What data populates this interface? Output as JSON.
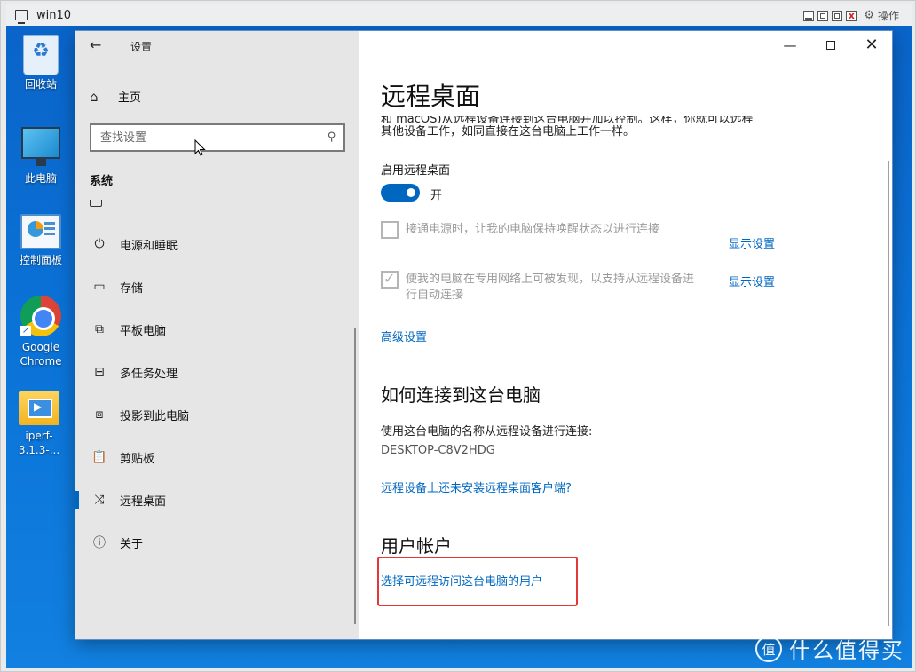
{
  "vm": {
    "title": "win10",
    "ops_label": "操作"
  },
  "desktop_icons": [
    {
      "label": "回收站"
    },
    {
      "label": "此电脑"
    },
    {
      "label": "控制面板"
    },
    {
      "label": "Google Chrome"
    },
    {
      "label": "iperf-3.1.3-..."
    }
  ],
  "settings": {
    "app_title": "设置",
    "home_label": "主页",
    "search_placeholder": "查找设置",
    "group_title": "系统",
    "nav_items": [
      {
        "label": "电源和睡眠",
        "icon": "power-icon"
      },
      {
        "label": "存储",
        "icon": "storage-icon"
      },
      {
        "label": "平板电脑",
        "icon": "tablet-icon"
      },
      {
        "label": "多任务处理",
        "icon": "multitask-icon"
      },
      {
        "label": "投影到此电脑",
        "icon": "project-icon"
      },
      {
        "label": "剪贴板",
        "icon": "clipboard-icon"
      },
      {
        "label": "远程桌面",
        "icon": "remote-desktop-icon",
        "active": true
      },
      {
        "label": "关于",
        "icon": "info-icon"
      }
    ],
    "main": {
      "title": "远程桌面",
      "clipped_text": "和 macOS)从远程设备连接到这台电脑并加以控制。这样，你就可以远程",
      "desc_line2": "其他设备工作，如同直接在这台电脑上工作一样。",
      "enable_label": "启用远程桌面",
      "toggle_state": "开",
      "toggle_on": true,
      "option1_text": "接通电源时，让我的电脑保持唤醒状态以进行连接",
      "option1_checked": false,
      "option1_link": "显示设置",
      "option2_text_line1": "使我的电脑在专用网络上可被发现，以支持从远程设备进",
      "option2_text_line2": "行自动连接",
      "option2_checked": true,
      "option2_link": "显示设置",
      "advanced_link": "高级设置",
      "how_connect_title": "如何连接到这台电脑",
      "how_connect_text": "使用这台电脑的名称从远程设备进行连接:",
      "pc_name": "DESKTOP-C8V2HDG",
      "no_client_link": "远程设备上还未安装远程桌面客户端?",
      "accounts_title": "用户帐户",
      "select_users_link": "选择可远程访问这台电脑的用户"
    }
  },
  "watermark": {
    "text": "什么值得买"
  }
}
